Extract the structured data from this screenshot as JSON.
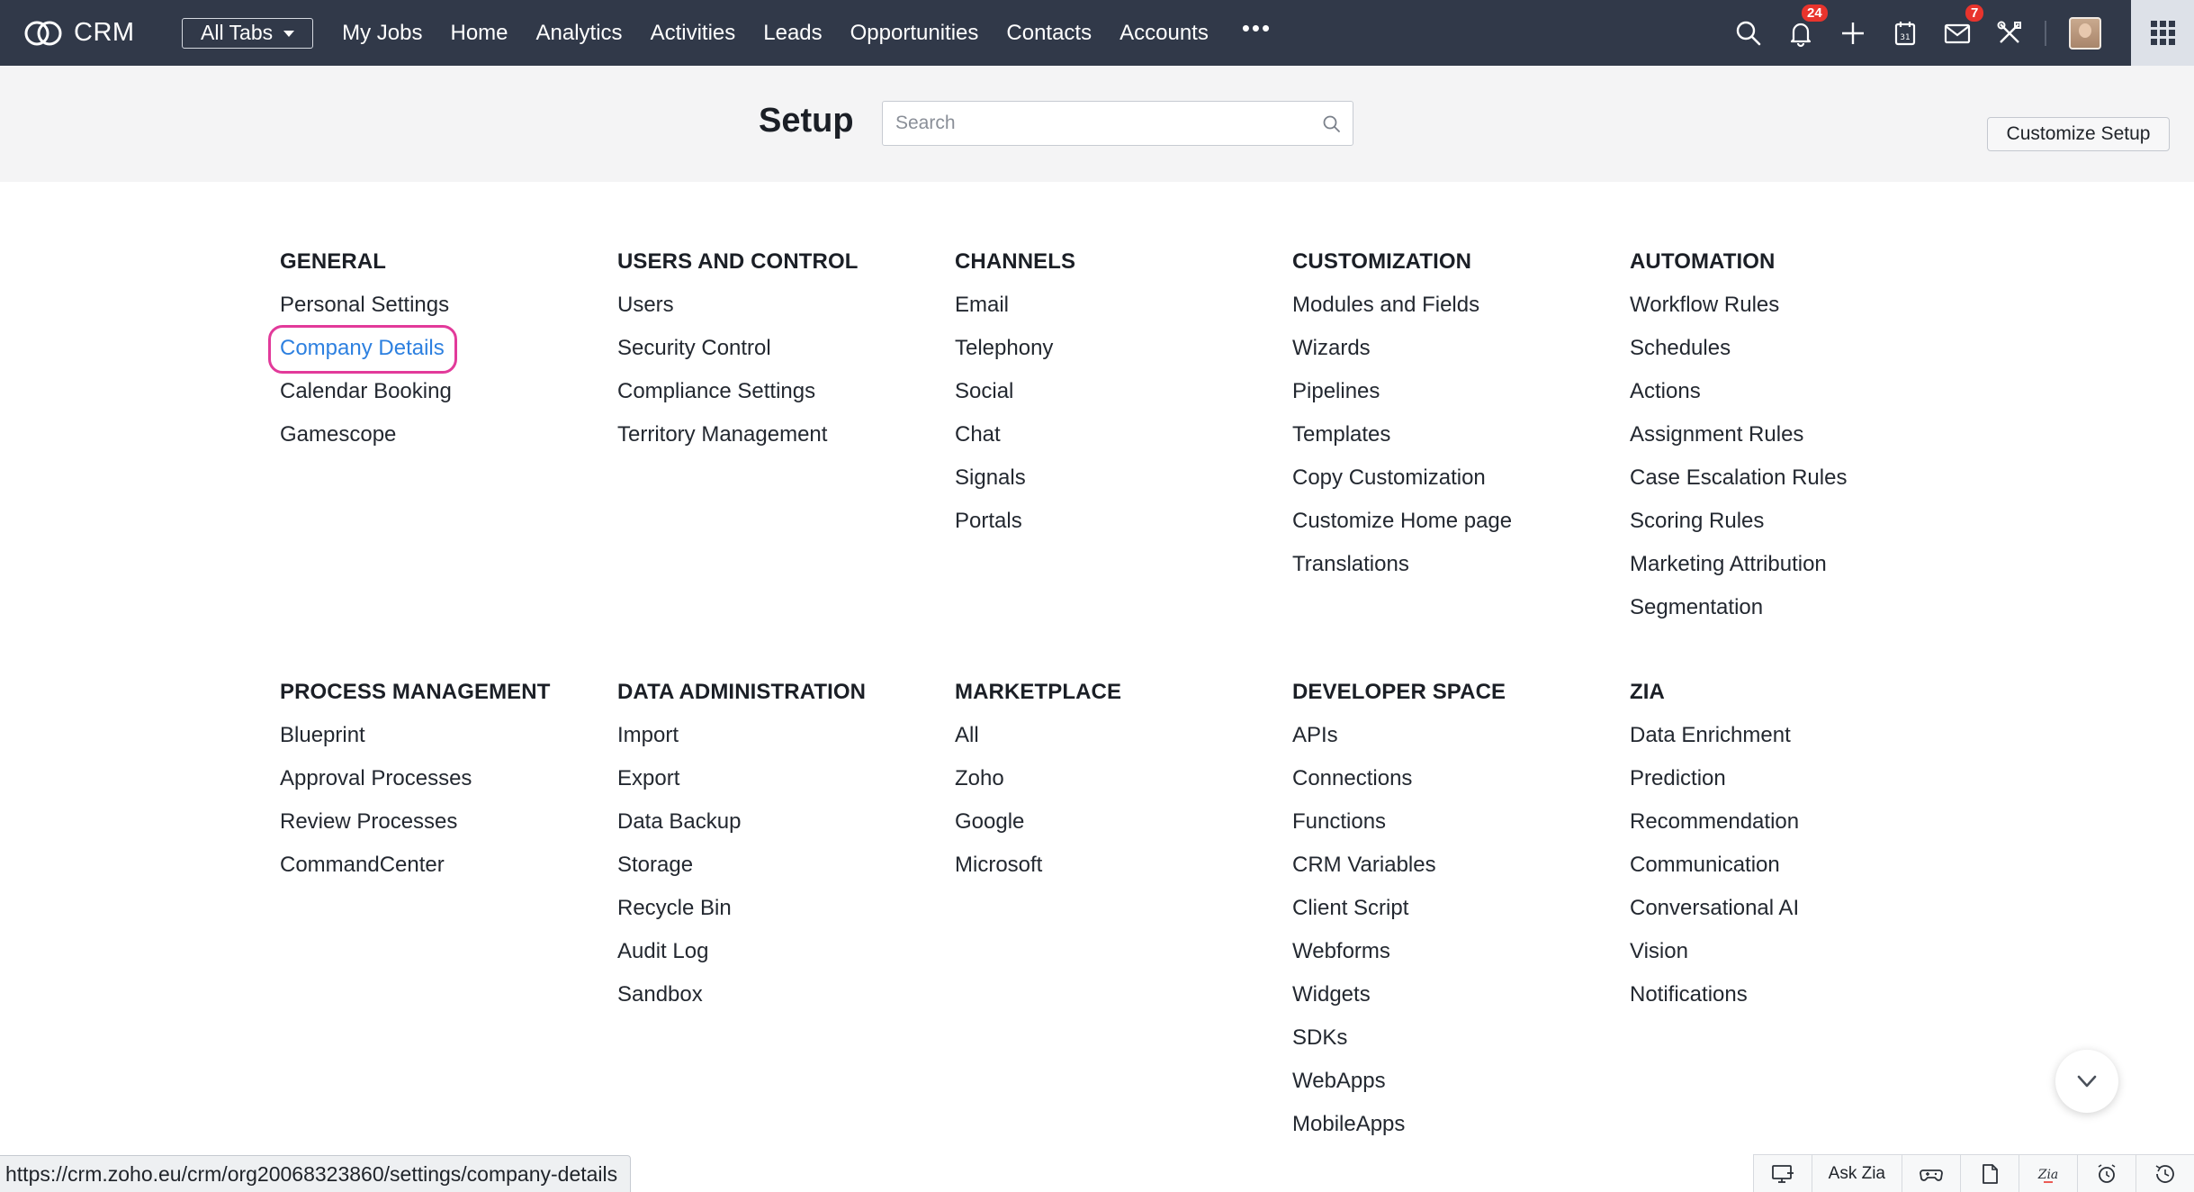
{
  "brand": {
    "name": "CRM"
  },
  "nav": {
    "all_tabs_label": "All Tabs",
    "tabs": [
      "My Jobs",
      "Home",
      "Analytics",
      "Activities",
      "Leads",
      "Opportunities",
      "Contacts",
      "Accounts"
    ],
    "more_label": "•••"
  },
  "top_icons": {
    "notifications_badge": "24",
    "mail_badge": "7",
    "icons": [
      "search-icon",
      "bell-icon",
      "plus-icon",
      "calendar-icon",
      "mail-icon",
      "tools-icon",
      "avatar",
      "apps-grid-icon"
    ]
  },
  "setup": {
    "title": "Setup",
    "search_placeholder": "Search",
    "customize_label": "Customize Setup"
  },
  "sections": [
    {
      "heading": "GENERAL",
      "items": [
        "Personal Settings",
        "Company Details",
        "Calendar Booking",
        "Gamescope"
      ]
    },
    {
      "heading": "USERS AND CONTROL",
      "items": [
        "Users",
        "Security Control",
        "Compliance Settings",
        "Territory Management"
      ]
    },
    {
      "heading": "CHANNELS",
      "items": [
        "Email",
        "Telephony",
        "Social",
        "Chat",
        "Signals",
        "Portals"
      ]
    },
    {
      "heading": "CUSTOMIZATION",
      "items": [
        "Modules and Fields",
        "Wizards",
        "Pipelines",
        "Templates",
        "Copy Customization",
        "Customize Home page",
        "Translations"
      ]
    },
    {
      "heading": "AUTOMATION",
      "items": [
        "Workflow Rules",
        "Schedules",
        "Actions",
        "Assignment Rules",
        "Case Escalation Rules",
        "Scoring Rules",
        "Marketing Attribution",
        "Segmentation"
      ]
    },
    {
      "heading": "PROCESS MANAGEMENT",
      "items": [
        "Blueprint",
        "Approval Processes",
        "Review Processes",
        "CommandCenter"
      ]
    },
    {
      "heading": "DATA ADMINISTRATION",
      "items": [
        "Import",
        "Export",
        "Data Backup",
        "Storage",
        "Recycle Bin",
        "Audit Log",
        "Sandbox"
      ]
    },
    {
      "heading": "MARKETPLACE",
      "items": [
        "All",
        "Zoho",
        "Google",
        "Microsoft"
      ]
    },
    {
      "heading": "DEVELOPER SPACE",
      "items": [
        "APIs",
        "Connections",
        "Functions",
        "CRM Variables",
        "Client Script",
        "Webforms",
        "Widgets",
        "SDKs",
        "WebApps",
        "MobileApps"
      ]
    },
    {
      "heading": "ZIA",
      "items": [
        "Data Enrichment",
        "Prediction",
        "Recommendation",
        "Communication",
        "Conversational AI",
        "Vision",
        "Notifications"
      ]
    }
  ],
  "active_item": "Company Details",
  "status_url": "https://crm.zoho.eu/crm/org20068323860/settings/company-details",
  "bottom_bar": {
    "ask_zia_label": "Ask Zia"
  },
  "colors": {
    "topbar": "#313949",
    "link_active": "#2d80e0",
    "highlight": "#e23a9a",
    "badge": "#e8342d"
  }
}
